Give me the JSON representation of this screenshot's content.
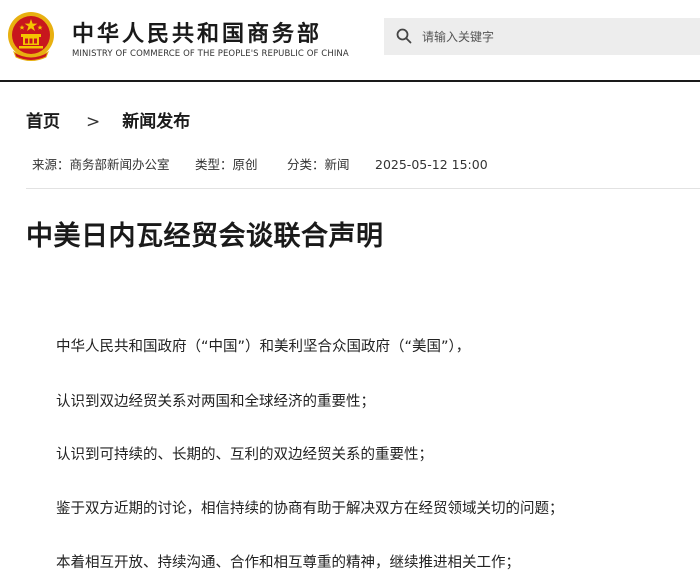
{
  "header": {
    "brand_cn": "中华人民共和国商务部",
    "brand_en": "MINISTRY OF COMMERCE OF THE PEOPLE'S REPUBLIC OF CHINA",
    "search_placeholder": "请输入关键字",
    "emblem_icon": "national-emblem-icon",
    "search_icon": "search-icon"
  },
  "breadcrumb": {
    "home": "首页",
    "separator": ">",
    "section": "新闻发布"
  },
  "meta": {
    "source": "来源：商务部新闻办公室",
    "type": "类型：原创",
    "category": "分类：新闻",
    "datetime": "2025-05-12 15:00"
  },
  "article": {
    "title": "中美日内瓦经贸会谈联合声明",
    "paragraphs": [
      "中华人民共和国政府（“中国”）和美利坚合众国政府（“美国”），",
      "认识到双边经贸关系对两国和全球经济的重要性；",
      "认识到可持续的、长期的、互利的双边经贸关系的重要性；",
      "鉴于双方近期的讨论，相信持续的协商有助于解决双方在经贸领域关切的问题；",
      "本着相互开放、持续沟通、合作和相互尊重的精神，继续推进相关工作；"
    ]
  },
  "colors": {
    "emblem_red": "#c8161d",
    "emblem_gold": "#e8b010",
    "search_bg": "#ededed",
    "header_border": "#1a1a1a"
  }
}
